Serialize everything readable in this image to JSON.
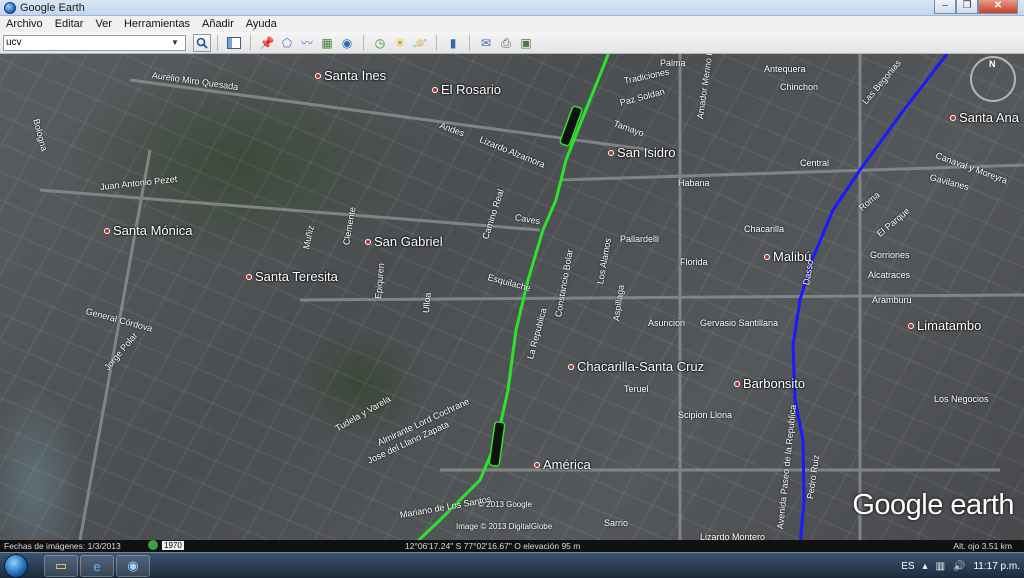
{
  "window": {
    "title": "Google Earth"
  },
  "menu": [
    "Archivo",
    "Editar",
    "Ver",
    "Herramientas",
    "Añadir",
    "Ayuda"
  ],
  "search": {
    "value": "ucv"
  },
  "toolbar_icons": [
    "sidebar-toggle-icon",
    "placemark-icon",
    "polygon-icon",
    "path-icon",
    "image-overlay-icon",
    "record-tour-icon",
    "historical-imagery-icon",
    "sunlight-icon",
    "planets-icon",
    "ruler-icon",
    "email-icon",
    "print-icon",
    "save-image-icon"
  ],
  "places": [
    {
      "name": "Santa Ines"
    },
    {
      "name": "El Rosario"
    },
    {
      "name": "San Isidro"
    },
    {
      "name": "Santa Mónica"
    },
    {
      "name": "San Gabriel"
    },
    {
      "name": "Santa Teresita"
    },
    {
      "name": "Malibú"
    },
    {
      "name": "Limatambo"
    },
    {
      "name": "Chacarilla-Santa Cruz"
    },
    {
      "name": "Barbonsito"
    },
    {
      "name": "América"
    },
    {
      "name": "Santa Ana"
    }
  ],
  "streets": [
    "Aurelio Miro Quesada",
    "Juan Antonio Pezet",
    "Lizardo Alzamora",
    "Camino Real",
    "Caves",
    "Esquilache",
    "La Republica",
    "Constancio Bolar",
    "Los Alamos",
    "Aspillaga",
    "Pallardelli",
    "Florida",
    "Chacarilla",
    "Aramburu",
    "Asuncion",
    "Gervasio Santillana",
    "Scipion Llona",
    "Teruel",
    "Sarrio",
    "Lizardo Montero",
    "Jorge Polar",
    "General Córdova",
    "Avenida Paseo de la Republica",
    "Canaval y Moreyra",
    "Gavilanes",
    "Gorriones",
    "Alcatraces",
    "Los Negocios",
    "Andes",
    "Tamayo",
    "Paz Soldan",
    "Tradiciones",
    "Habana",
    "Central",
    "Amador Merino Reyna",
    "Clemente",
    "Muñiz",
    "Epiquren",
    "Ulloa",
    "Tudela y Varela",
    "Jose del Llano Zapata",
    "Almirante Lord Cochrane",
    "Mariano de Los Santos",
    "Pedro Ruiz",
    "Dasso",
    "Roma",
    "El Parque",
    "Las Begonias",
    "Antequera",
    "Chinchon",
    "Palma",
    "Bologna"
  ],
  "map_text": {
    "copyright_google": "© 2013 Google",
    "copyright_dg": "Image © 2013 DigitalGlobe",
    "logo": "Google earth",
    "compass_n": "N"
  },
  "status": {
    "image_date": "Fechas de imágenes: 1/3/2013",
    "year": "1970",
    "coords": "12°06'17.24\" S  77°02'16.67\" O  elevación   95 m",
    "eye_alt": "Alt. ojo    3.51 km"
  },
  "taskbar": {
    "lang": "ES",
    "time": "11:17 p.m."
  },
  "colors": {
    "route_green": "#2be32b",
    "route_blue": "#1a1aff",
    "marker_red": "#c0302a"
  }
}
